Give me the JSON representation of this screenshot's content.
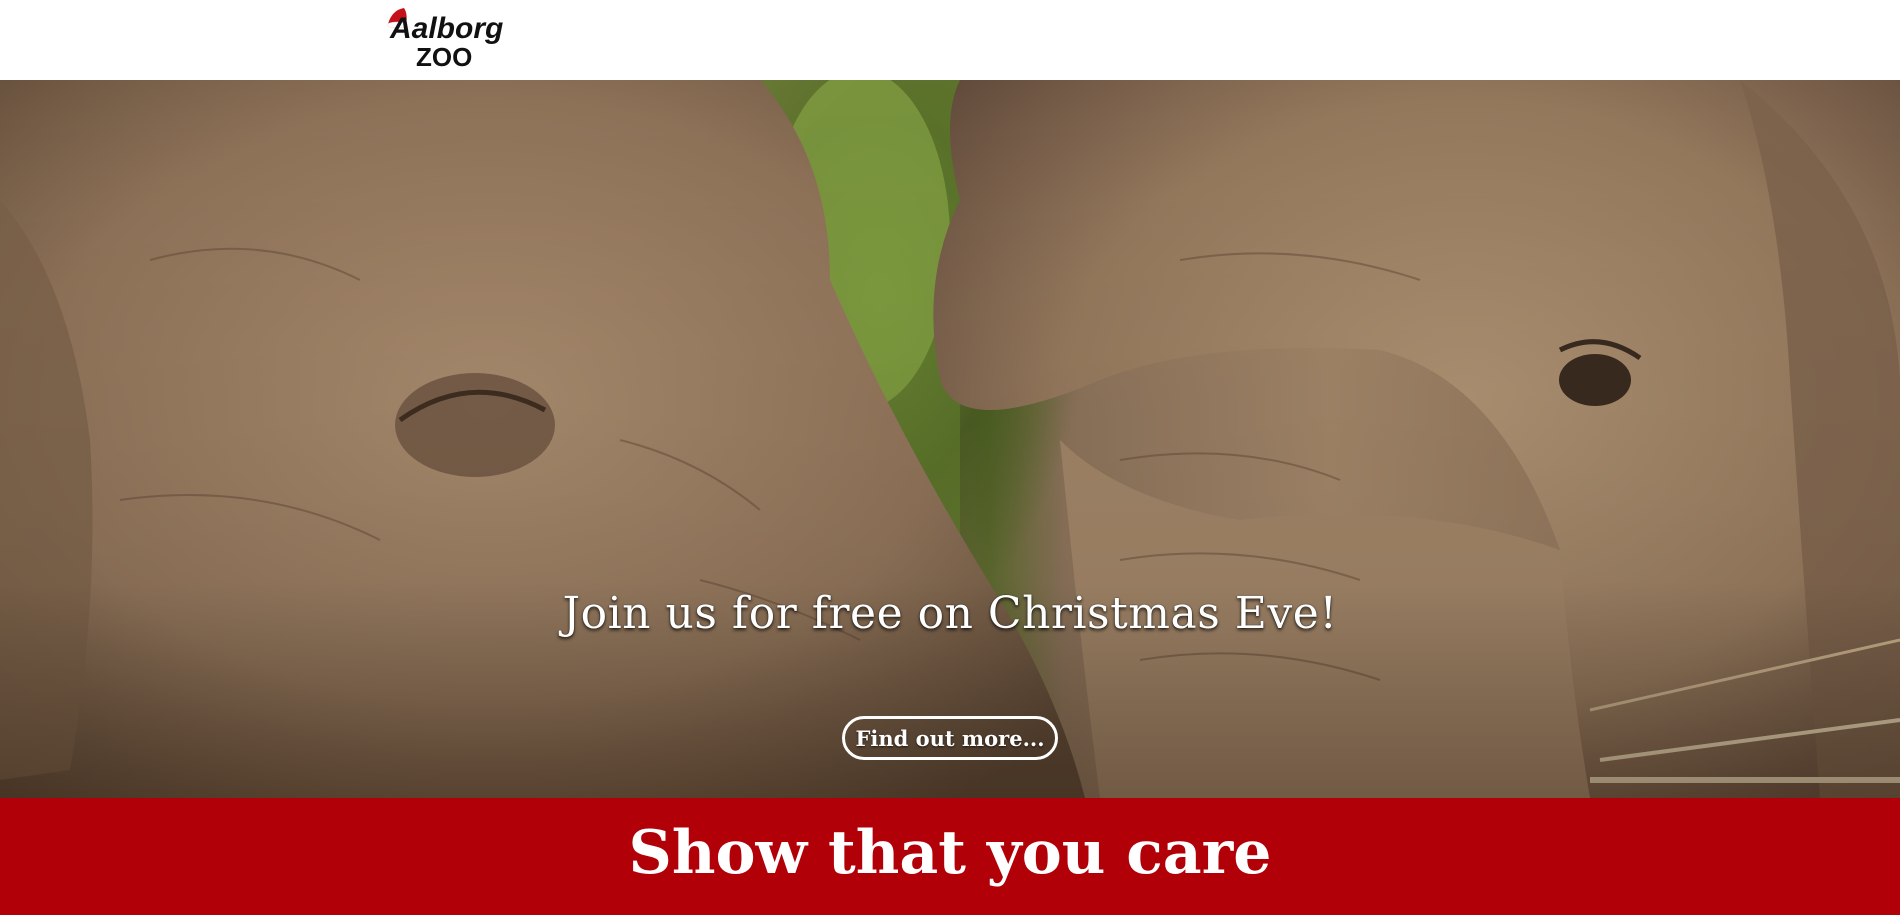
{
  "header": {
    "logo": {
      "line1": "Aalborg",
      "line2": "ZOO"
    }
  },
  "hero": {
    "title": "Join us for free on Christmas Eve!",
    "button_label": "Find out more..."
  },
  "care_band": {
    "title": "Show that you care"
  },
  "colors": {
    "brand_red": "#b20008",
    "header_bg": "#ffffff",
    "text_light": "#ffffff"
  }
}
